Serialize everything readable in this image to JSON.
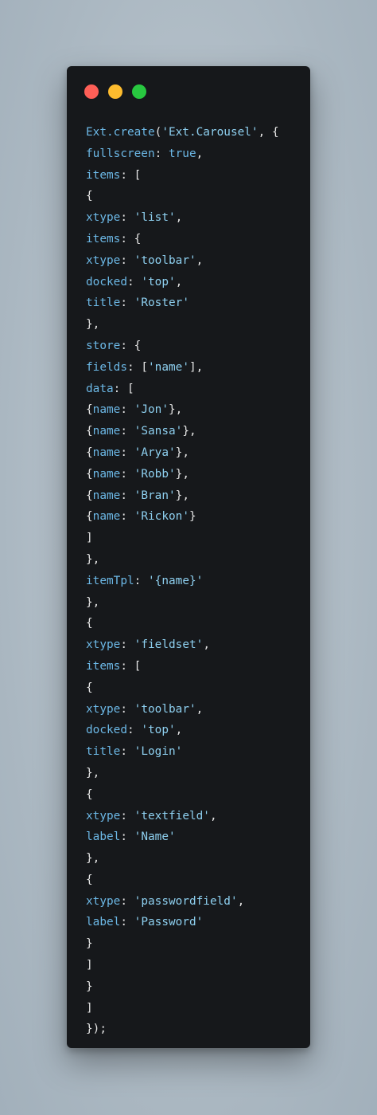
{
  "window": {
    "controls": [
      "close",
      "minimize",
      "maximize"
    ],
    "colors": {
      "close": "#fe5f57",
      "minimize": "#febc2e",
      "maximize": "#28c840",
      "background": "#16181b"
    }
  },
  "code": {
    "lines": [
      "Ext.create('Ext.Carousel', {",
      "fullscreen: true,",
      "items: [",
      "{",
      "xtype: 'list',",
      "items: {",
      "xtype: 'toolbar',",
      "docked: 'top',",
      "title: 'Roster'",
      "},",
      "store: {",
      "fields: ['name'],",
      "data: [",
      "{name: 'Jon'},",
      "{name: 'Sansa'},",
      "{name: 'Arya'},",
      "{name: 'Robb'},",
      "{name: 'Bran'},",
      "{name: 'Rickon'}",
      "]",
      "},",
      "itemTpl: '{name}'",
      "},",
      "{",
      "xtype: 'fieldset',",
      "items: [",
      "{",
      "xtype: 'toolbar',",
      "docked: 'top',",
      "title: 'Login'",
      "},",
      "{",
      "xtype: 'textfield',",
      "label: 'Name'",
      "},",
      "{",
      "xtype: 'passwordfield',",
      "label: 'Password'",
      "}",
      "]",
      "}",
      "]",
      "});"
    ]
  }
}
